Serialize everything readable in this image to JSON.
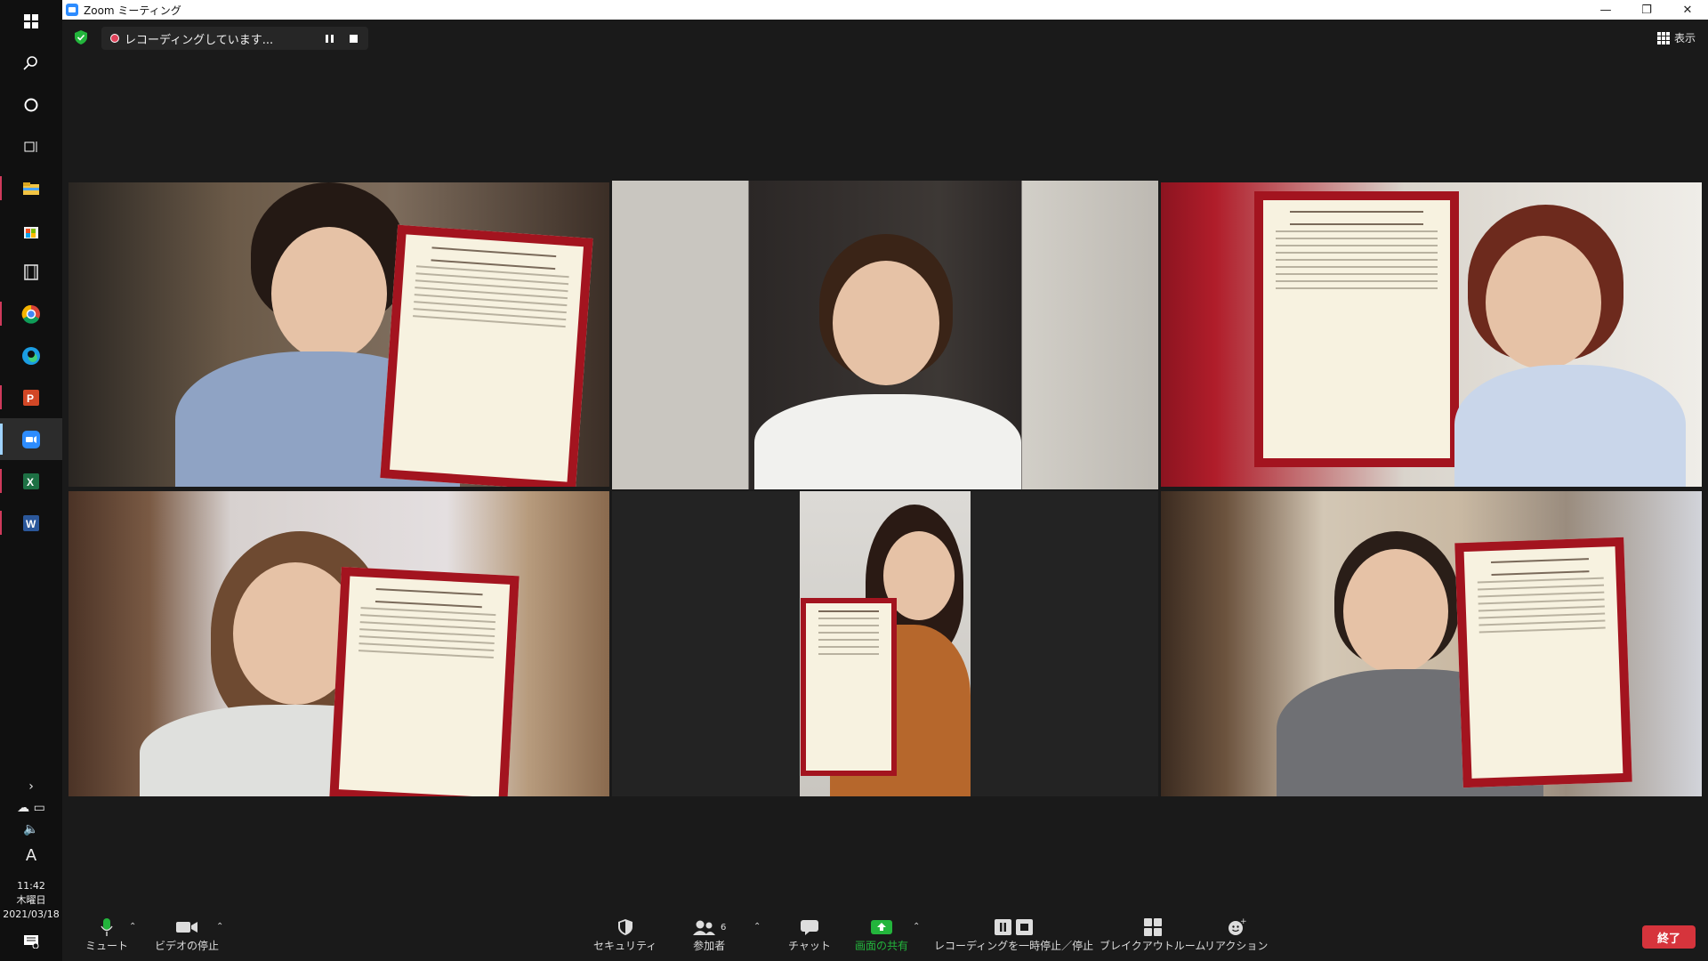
{
  "window": {
    "title": "Zoom ミーティング",
    "minimize": "—",
    "maximize": "❐",
    "close": "✕"
  },
  "top_bar": {
    "recording_status": "レコーディングしています...",
    "view_label": "表示"
  },
  "taskbar": {
    "time": "11:42",
    "weekday": "木曜日",
    "date": "2021/03/18",
    "ime": "A"
  },
  "toolbar": {
    "mute": "ミュート",
    "stop_video": "ビデオの停止",
    "security": "セキュリティ",
    "participants": "参加者",
    "participant_count": "6",
    "chat": "チャット",
    "share_screen": "画面の共有",
    "recording_control": "レコーディングを一時停止／停止",
    "breakout_rooms": "ブレイクアウトルーム",
    "reactions": "リアクション",
    "end": "終了"
  },
  "colors": {
    "speaker_border": "#d8e84a",
    "share_green": "#23b53c",
    "end_red": "#d6343c",
    "cert_frame": "#a3141f"
  },
  "participants_tiles": [
    {
      "id": "tile-1",
      "holds_certificate": true
    },
    {
      "id": "tile-2",
      "holds_certificate": false,
      "active_speaker": true
    },
    {
      "id": "tile-3",
      "holds_certificate": true
    },
    {
      "id": "tile-4",
      "holds_certificate": true
    },
    {
      "id": "tile-5",
      "holds_certificate": true
    },
    {
      "id": "tile-6",
      "holds_certificate": true
    }
  ]
}
